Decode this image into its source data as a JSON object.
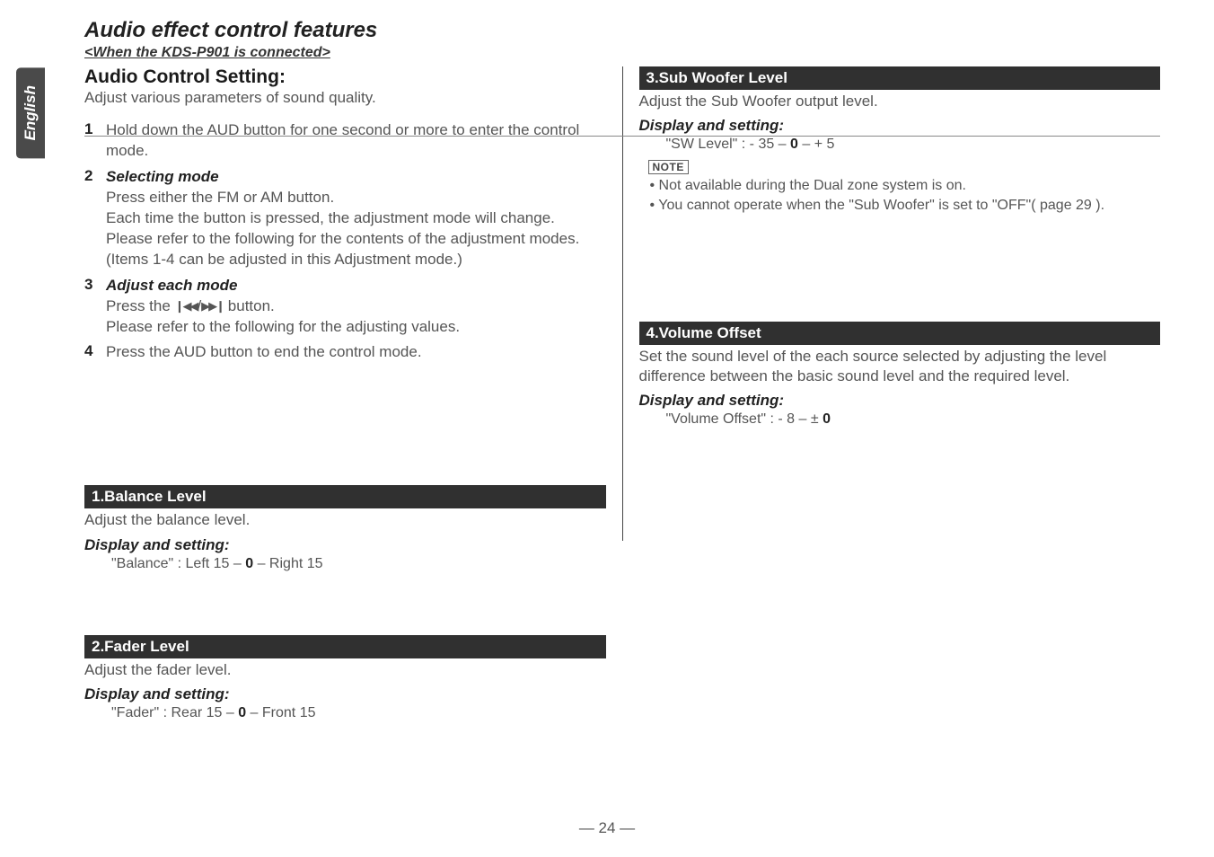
{
  "page": {
    "language": "English",
    "title": "Audio effect control features",
    "subtitle": "<When the KDS-P901 is connected>",
    "number": "— 24 —"
  },
  "left": {
    "setting_title": "Audio Control Setting:",
    "setting_desc": "Adjust various parameters of sound quality.",
    "steps": [
      {
        "num": "1",
        "heading": "",
        "text": "Hold down the AUD button for one second or more to enter the control mode."
      },
      {
        "num": "2",
        "heading": "Selecting mode",
        "text": "Press either the FM or AM button.\nEach time the button is pressed, the adjustment mode will change.\nPlease refer to the following for the contents of the adjustment modes.(Items 1-4 can be adjusted in this Adjustment mode.)"
      },
      {
        "num": "3",
        "heading": "Adjust each mode",
        "text_pre": "Press the ",
        "text_post": " button.\nPlease refer to the following for the adjusting values."
      },
      {
        "num": "4",
        "heading": "",
        "text": "Press the AUD button to end the control mode."
      }
    ],
    "balance": {
      "bar": "1.Balance Level",
      "desc": "Adjust the balance level.",
      "setting_label": "Display and setting:",
      "value_pre": "\"Balance\" : Left 15  –  ",
      "value_bold": "0",
      "value_post": "  –  Right 15"
    },
    "fader": {
      "bar": "2.Fader Level",
      "desc": "Adjust the fader level.",
      "setting_label": "Display and setting:",
      "value_pre": "\"Fader\" : Rear 15  –  ",
      "value_bold": "0",
      "value_post": "  –  Front 15"
    }
  },
  "right": {
    "subwoofer": {
      "bar": "3.Sub Woofer Level",
      "desc": "Adjust the Sub Woofer output level.",
      "setting_label": "Display and setting:",
      "value_pre": "\"SW Level\" : - 35  –  ",
      "value_bold": "0",
      "value_post": "  –  + 5",
      "note_label": "NOTE",
      "notes": [
        "Not available during the Dual zone system is on.",
        "You cannot operate when the \"Sub Woofer\" is set to \"OFF\"( page 29 )."
      ]
    },
    "volume": {
      "bar": "4.Volume Offset",
      "desc": "Set the sound level of the each source selected by adjusting the level difference between the basic sound level and the required level.",
      "setting_label": "Display and setting:",
      "value_pre": "\"Volume Offset\" : - 8  –  ± ",
      "value_bold": "0",
      "value_post": ""
    }
  }
}
